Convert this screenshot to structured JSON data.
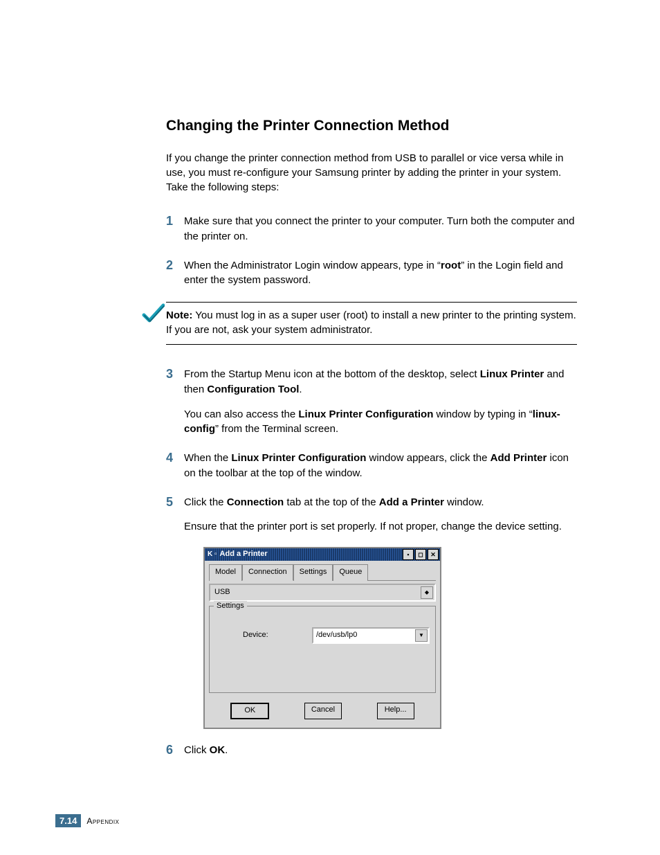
{
  "title": "Changing the Printer Connection Method",
  "intro": "If you change the printer connection method from USB to parallel or vice versa while in use, you must re-configure your Samsung printer by adding the printer in your system. Take the following steps:",
  "steps": {
    "s1_num": "1",
    "s1_text": "Make sure that you connect the printer to your computer. Turn both the computer and the printer on.",
    "s2_num": "2",
    "s2_text_pre": "When the Administrator Login window appears, type in “",
    "s2_bold": "root",
    "s2_text_post": "” in the Login field and enter the system password.",
    "s3_num": "3",
    "s3_p1_pre": "From the Startup Menu icon at the bottom of the desktop, select ",
    "s3_p1_b1": "Linux Printer",
    "s3_p1_mid": " and then ",
    "s3_p1_b2": "Configuration Tool",
    "s3_p1_end": ".",
    "s3_p2_pre": "You can also access the ",
    "s3_p2_b1": "Linux Printer Configuration",
    "s3_p2_mid": " window by typing in “",
    "s3_p2_b2": "linux-config",
    "s3_p2_post": "” from the Terminal screen.",
    "s4_num": "4",
    "s4_pre": "When the ",
    "s4_b1": "Linux Printer Configuration",
    "s4_mid": " window appears, click the ",
    "s4_b2": "Add Printer",
    "s4_post": " icon on the toolbar at the top of the window.",
    "s5_num": "5",
    "s5_p1_pre": "Click the ",
    "s5_p1_b1": "Connection",
    "s5_p1_mid": " tab at the top of the ",
    "s5_p1_b2": "Add a Printer",
    "s5_p1_post": " window.",
    "s5_p2": "Ensure that the printer port is set properly. If not proper, change the device setting.",
    "s6_num": "6",
    "s6_pre": "Click ",
    "s6_b": "OK",
    "s6_post": "."
  },
  "note": {
    "label": "Note:",
    "text": " You must log in as a super user (root) to install a new printer to the printing system. If you are not, ask your system administrator."
  },
  "dialog": {
    "title": "Add a Printer",
    "tabs": {
      "model": "Model",
      "connection": "Connection",
      "settings": "Settings",
      "queue": "Queue"
    },
    "port": "USB",
    "group": "Settings",
    "device_label": "Device:",
    "device_value": "/dev/usb/lp0",
    "buttons": {
      "ok": "OK",
      "cancel": "Cancel",
      "help": "Help..."
    }
  },
  "footer": {
    "page_prefix": "7.",
    "page_num": "14",
    "section": "Appendix"
  }
}
